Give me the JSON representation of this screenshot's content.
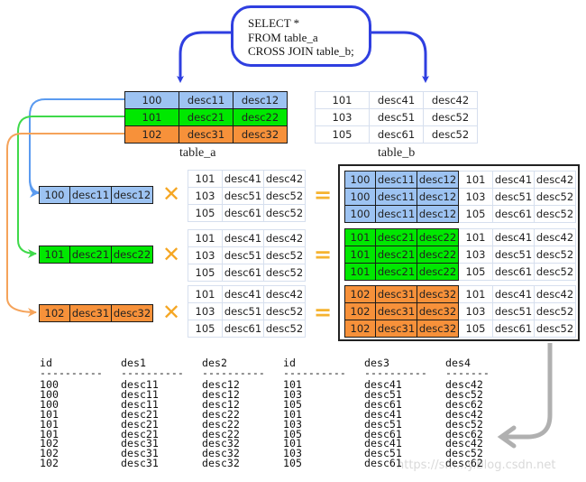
{
  "sql": {
    "lines": [
      "SELECT *",
      "FROM table_a",
      "CROSS JOIN table_b;"
    ]
  },
  "colors": {
    "sql_border": "#2f3fe0",
    "row_blue": "#9dc3f2",
    "row_green": "#00e800",
    "row_orange": "#f7913a",
    "operator": "#f5a623",
    "return_arrow": "#b0b0b0"
  },
  "table_a": {
    "caption": "table_a",
    "rows": [
      [
        "100",
        "desc11",
        "desc12"
      ],
      [
        "101",
        "desc21",
        "desc22"
      ],
      [
        "102",
        "desc31",
        "desc32"
      ]
    ]
  },
  "table_b": {
    "caption": "table_b",
    "rows": [
      [
        "101",
        "desc41",
        "desc42"
      ],
      [
        "103",
        "desc51",
        "desc52"
      ],
      [
        "105",
        "desc61",
        "desc52"
      ]
    ]
  },
  "operators": {
    "times": "✕",
    "equals": "="
  },
  "result_grid": [
    [
      "100",
      "desc11",
      "desc12",
      "101",
      "desc41",
      "desc42"
    ],
    [
      "100",
      "desc11",
      "desc12",
      "103",
      "desc51",
      "desc52"
    ],
    [
      "100",
      "desc11",
      "desc12",
      "105",
      "desc61",
      "desc52"
    ],
    [
      "101",
      "desc21",
      "desc22",
      "101",
      "desc41",
      "desc42"
    ],
    [
      "101",
      "desc21",
      "desc22",
      "103",
      "desc51",
      "desc52"
    ],
    [
      "101",
      "desc21",
      "desc22",
      "105",
      "desc61",
      "desc52"
    ],
    [
      "102",
      "desc31",
      "desc32",
      "101",
      "desc41",
      "desc42"
    ],
    [
      "102",
      "desc31",
      "desc32",
      "103",
      "desc51",
      "desc52"
    ],
    [
      "102",
      "desc31",
      "desc32",
      "105",
      "desc61",
      "desc52"
    ]
  ],
  "console": {
    "headers": [
      "id",
      "des1",
      "des2",
      "id",
      "des3",
      "des4"
    ],
    "separators": [
      "----------",
      "----------",
      "----------",
      "----------",
      "----------",
      "-------"
    ],
    "rows": [
      [
        "100",
        "desc11",
        "desc12",
        "101",
        "desc41",
        "desc42"
      ],
      [
        "100",
        "desc11",
        "desc12",
        "103",
        "desc51",
        "desc52"
      ],
      [
        "100",
        "desc11",
        "desc12",
        "105",
        "desc61",
        "desc62"
      ],
      [
        "101",
        "desc21",
        "desc22",
        "101",
        "desc41",
        "desc42"
      ],
      [
        "101",
        "desc21",
        "desc22",
        "103",
        "desc51",
        "desc52"
      ],
      [
        "101",
        "desc21",
        "desc22",
        "105",
        "desc61",
        "desc62"
      ],
      [
        "102",
        "desc31",
        "desc32",
        "101",
        "desc41",
        "desc42"
      ],
      [
        "102",
        "desc31",
        "desc32",
        "103",
        "desc51",
        "desc52"
      ],
      [
        "102",
        "desc31",
        "desc32",
        "105",
        "desc61",
        "desc62"
      ]
    ]
  },
  "watermark": "https://sm...y.blog.csdn.net"
}
